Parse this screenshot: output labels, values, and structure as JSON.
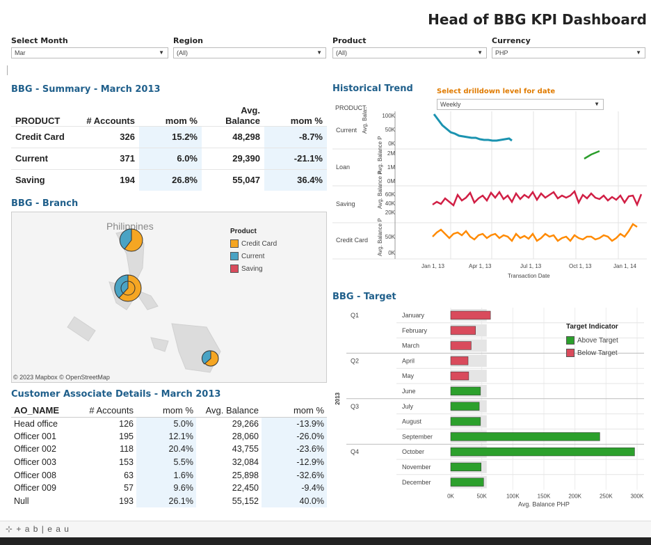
{
  "title": "Head of BBG KPI Dashboard",
  "filters": [
    {
      "label": "Select Month",
      "value": "Mar"
    },
    {
      "label": "Region",
      "value": "(All)"
    },
    {
      "label": "Product",
      "value": "(All)"
    },
    {
      "label": "Currency",
      "value": "PHP"
    }
  ],
  "summary": {
    "title": "BBG - Summary - March 2013",
    "headers": [
      "PRODUCT",
      "# Accounts",
      "mom %",
      "Avg.\nBalance",
      "mom %"
    ],
    "rows": [
      {
        "product": "Credit Card",
        "accounts": "326",
        "mom1": "15.2%",
        "balance": "48,298",
        "mom2": "-8.7%"
      },
      {
        "product": "Current",
        "accounts": "371",
        "mom1": "6.0%",
        "balance": "29,390",
        "mom2": "-21.1%"
      },
      {
        "product": "Saving",
        "accounts": "194",
        "mom1": "26.8%",
        "balance": "55,047",
        "mom2": "36.4%"
      }
    ]
  },
  "branch": {
    "title": "BBG - Branch",
    "map_label": "Philippines",
    "attribution": "© 2023 Mapbox © OpenStreetMap",
    "legend_title": "Product",
    "legend": [
      {
        "label": "Credit Card",
        "color": "#f5a623"
      },
      {
        "label": "Current",
        "color": "#4aa3c4"
      },
      {
        "label": "Saving",
        "color": "#d94b5c"
      }
    ]
  },
  "customer": {
    "title": "Customer Associate Details - March 2013",
    "headers": [
      "AO_NAME",
      "# Accounts",
      "mom %",
      "Avg. Balance",
      "mom %"
    ],
    "rows": [
      {
        "name": "Head office",
        "accounts": "126",
        "mom1": "5.0%",
        "balance": "29,266",
        "mom2": "-13.9%"
      },
      {
        "name": "Officer 001",
        "accounts": "195",
        "mom1": "12.1%",
        "balance": "28,060",
        "mom2": "-26.0%"
      },
      {
        "name": "Officer 002",
        "accounts": "118",
        "mom1": "20.4%",
        "balance": "43,755",
        "mom2": "-23.6%"
      },
      {
        "name": "Officer 003",
        "accounts": "153",
        "mom1": "5.5%",
        "balance": "32,084",
        "mom2": "-12.9%"
      },
      {
        "name": "Officer 008",
        "accounts": "63",
        "mom1": "1.6%",
        "balance": "25,898",
        "mom2": "-32.6%"
      },
      {
        "name": "Officer 009",
        "accounts": "57",
        "mom1": "9.6%",
        "balance": "22,450",
        "mom2": "-9.4%"
      },
      {
        "name": "Null",
        "accounts": "193",
        "mom1": "26.1%",
        "balance": "55,152",
        "mom2": "40.0%"
      }
    ]
  },
  "trend": {
    "title": "Historical Trend",
    "drilldown_label": "Select drilldown level for date",
    "drilldown_value": "Weekly",
    "col_header": "PRODUCT",
    "rows": [
      {
        "label": "Current",
        "axis_label": "Avg. Bala..",
        "ticks": [
          "100K",
          "50K",
          "0K"
        ]
      },
      {
        "label": "Loan",
        "axis_label": "Avg. Balance P",
        "ticks": [
          "2M",
          "1M",
          "0M"
        ]
      },
      {
        "label": "Saving",
        "axis_label": "Avg. Balance P",
        "ticks": [
          "60K",
          "40K",
          "20K"
        ]
      },
      {
        "label": "Credit Card",
        "axis_label": "Avg. Balance P",
        "ticks": [
          "50K",
          "0K"
        ]
      }
    ],
    "x_ticks": [
      "Jan 1, 13",
      "Apr 1, 13",
      "Jul 1, 13",
      "Oct 1, 13",
      "Jan 1, 14"
    ],
    "x_title": "Transaction Date"
  },
  "chart_data": {
    "type": "bar",
    "title": "BBG - Target",
    "year_label": "2013",
    "quarters": [
      "Q1",
      "Q2",
      "Q3",
      "Q4"
    ],
    "categories": [
      "January",
      "February",
      "March",
      "April",
      "May",
      "June",
      "July",
      "August",
      "September",
      "October",
      "November",
      "December"
    ],
    "values": [
      64000,
      40000,
      33000,
      28000,
      29000,
      48000,
      46000,
      48000,
      240000,
      296000,
      49000,
      53000
    ],
    "indicator": [
      "Below Target",
      "Below Target",
      "Below Target",
      "Below Target",
      "Below Target",
      "Above Target",
      "Above Target",
      "Above Target",
      "Above Target",
      "Above Target",
      "Above Target",
      "Above Target"
    ],
    "xlabel": "Avg. Balance PHP",
    "x_ticks": [
      "0K",
      "50K",
      "100K",
      "150K",
      "200K",
      "250K",
      "300K"
    ],
    "xlim": [
      0,
      300000
    ],
    "legend_title": "Target Indicator",
    "legend": [
      {
        "label": "Above Target",
        "color": "#2ca02c"
      },
      {
        "label": "Below Target",
        "color": "#d94b5c"
      }
    ]
  },
  "footer": {
    "brand": "+ a b | e a u"
  }
}
